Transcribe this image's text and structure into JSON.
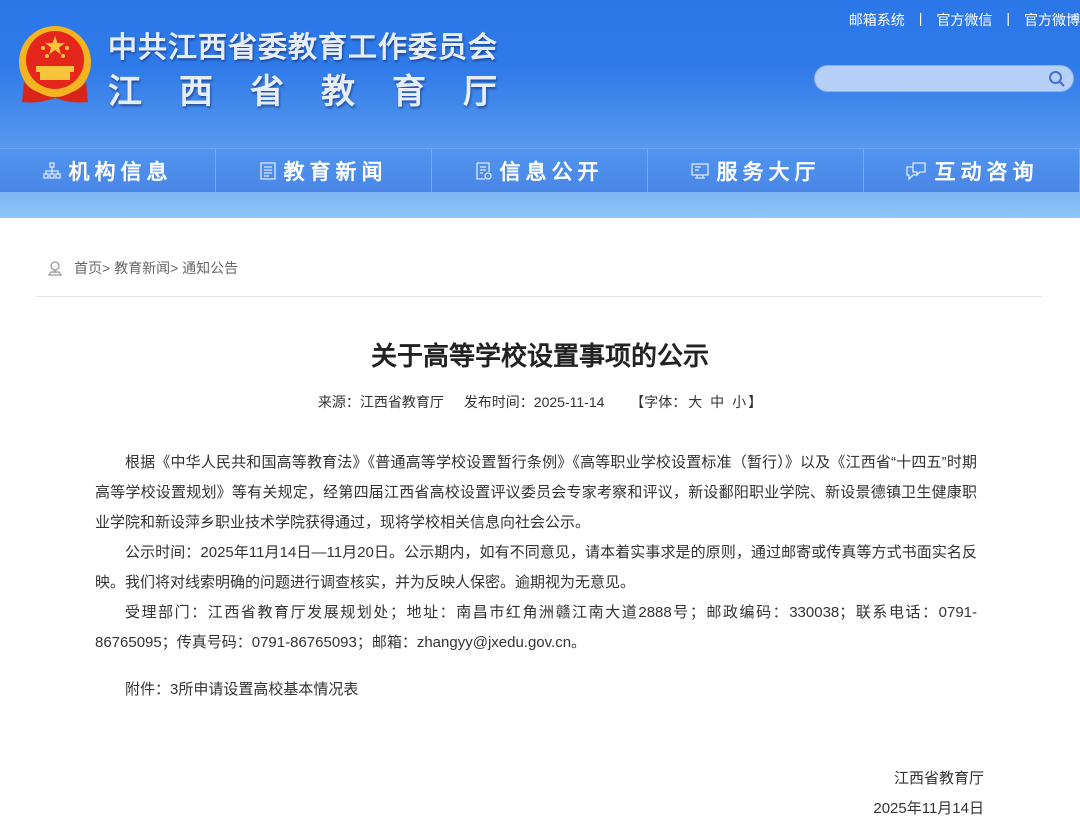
{
  "header": {
    "org_line1": "中共江西省委教育工作委员会",
    "org_line2": "江西省教育厅",
    "top_links": [
      "邮箱系统",
      "官方微信",
      "官方微博"
    ],
    "search_placeholder": ""
  },
  "nav": [
    {
      "label": "机构信息",
      "icon": "org-chart-icon"
    },
    {
      "label": "教育新闻",
      "icon": "document-icon"
    },
    {
      "label": "信息公开",
      "icon": "file-list-icon"
    },
    {
      "label": "服务大厅",
      "icon": "monitor-icon"
    },
    {
      "label": "互动咨询",
      "icon": "chat-bubbles-icon"
    }
  ],
  "breadcrumb": {
    "items": [
      "首页",
      "教育新闻",
      "通知公告"
    ],
    "separator": ">"
  },
  "article": {
    "title": "关于高等学校设置事项的公示",
    "source_label": "来源：江西省教育厅",
    "date_label": "发布时间：2025-11-14",
    "font_size_prefix": "【字体：",
    "font_sizes": [
      "大",
      "中",
      "小"
    ],
    "font_size_suffix": "】",
    "paragraphs": [
      "根据《中华人民共和国高等教育法》《普通高等学校设置暂行条例》《高等职业学校设置标准（暂行）》以及《江西省“十四五”时期高等学校设置规划》等有关规定，经第四届江西省高校设置评议委员会专家考察和评议，新设鄱阳职业学院、新设景德镇卫生健康职业学院和新设萍乡职业技术学院获得通过，现将学校相关信息向社会公示。",
      "公示时间：2025年11月14日—11月20日。公示期内，如有不同意见，请本着实事求是的原则，通过邮寄或传真等方式书面实名反映。我们将对线索明确的问题进行调查核实，并为反映人保密。逾期视为无意见。",
      "受理部门：江西省教育厅发展规划处；地址：南昌市红角洲赣江南大道2888号；邮政编码：330038；联系电话：0791-86765095；传真号码：0791-86765093；邮箱：zhangyy@jxedu.gov.cn。"
    ],
    "attachment_label": "附件：",
    "attachment_link": "3所申请设置高校基本情况表",
    "signature_org": "江西省教育厅",
    "signature_date": "2025年11月14日"
  },
  "colors": {
    "header_blue": "#2c77e8",
    "nav_blue": "#4a86e6",
    "band_blue": "#8fc6f8"
  }
}
